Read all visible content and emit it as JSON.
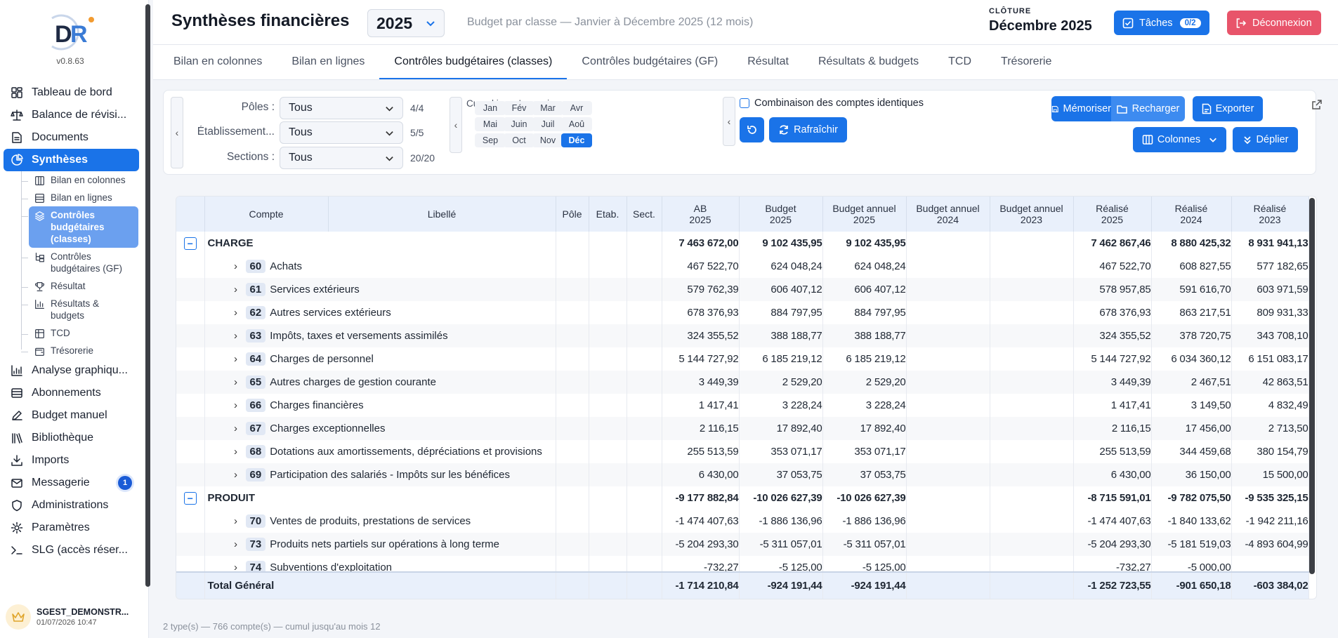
{
  "app": {
    "version": "v0.8.63",
    "user_name": "SGEST_DEMONSTR...",
    "user_date": "01/07/2026 10:47"
  },
  "sidebar": {
    "items": [
      {
        "label": "Tableau de bord",
        "icon": "dashboard-icon"
      },
      {
        "label": "Balance de révisi...",
        "icon": "scale-icon"
      },
      {
        "label": "Documents",
        "icon": "document-icon"
      },
      {
        "label": "Synthèses",
        "icon": "pie-chart-icon",
        "active": true
      }
    ],
    "sub_items": [
      {
        "label": "Bilan en colonnes",
        "icon": "columns-icon"
      },
      {
        "label": "Bilan en lignes",
        "icon": "rows-icon"
      },
      {
        "label": "Contrôles budgétaires (classes)",
        "icon": "layers-icon",
        "active": true
      },
      {
        "label": "Contrôles budgétaires (GF)",
        "icon": "hierarchy-icon"
      },
      {
        "label": "Résultat",
        "icon": "trophy-icon"
      },
      {
        "label": "Résultats & budgets",
        "icon": "bar-chart-icon"
      },
      {
        "label": "TCD",
        "icon": "table-icon"
      },
      {
        "label": "Trésorerie",
        "icon": "wallet-icon"
      }
    ],
    "items_after": [
      {
        "label": "Analyse graphiqu...",
        "icon": "chart-icon"
      },
      {
        "label": "Abonnements",
        "icon": "card-icon"
      },
      {
        "label": "Budget manuel",
        "icon": "pen-icon"
      },
      {
        "label": "Bibliothèque",
        "icon": "library-icon"
      },
      {
        "label": "Imports",
        "icon": "download-icon"
      },
      {
        "label": "Messagerie",
        "icon": "mail-icon",
        "badge": "1"
      },
      {
        "label": "Administrations",
        "icon": "shield-icon"
      },
      {
        "label": "Paramètres",
        "icon": "gear-icon"
      },
      {
        "label": "SLG (accès réser...",
        "icon": "terminal-icon"
      }
    ]
  },
  "header": {
    "title": "Synthèses financières",
    "year": "2025",
    "subtitle": "Budget par classe — Janvier à Décembre 2025 (12 mois)",
    "cloture_label": "CLÔTURE",
    "cloture_value": "Décembre 2025",
    "taches_label": "Tâches",
    "taches_count": "0/2",
    "deconnexion_label": "Déconnexion"
  },
  "tabs": [
    "Bilan en colonnes",
    "Bilan en lignes",
    "Contrôles budgétaires (classes)",
    "Contrôles budgétaires (GF)",
    "Résultat",
    "Résultats & budgets",
    "TCD",
    "Trésorerie"
  ],
  "active_tab": 2,
  "filters": {
    "poles_label": "Pôles :",
    "poles_value": "Tous",
    "poles_count": "4/4",
    "etab_label": "Établissement...",
    "etab_value": "Tous",
    "etab_count": "5/5",
    "sections_label": "Sections :",
    "sections_value": "Tous",
    "sections_count": "20/20",
    "cumul_label": "Cumul jusqu'au mois :",
    "months": [
      "Jan",
      "Fév",
      "Mar",
      "Avr",
      "Mai",
      "Juin",
      "Juil",
      "Aoû",
      "Sep",
      "Oct",
      "Nov",
      "Déc"
    ],
    "selected_month": 11,
    "combinaison_label": "Combinaison des comptes identiques",
    "rafraichir_label": "Rafraîchir",
    "memoriser_label": "Mémoriser",
    "recharger_label": "Recharger",
    "exporter_label": "Exporter",
    "colonnes_label": "Colonnes",
    "deplier_label": "Déplier"
  },
  "table": {
    "headers": {
      "compte": "Compte",
      "libelle": "Libellé",
      "pole": "Pôle",
      "etab": "Etab.",
      "sect": "Sect.",
      "ab2025_1": "AB",
      "ab2025_2": "2025",
      "b2025_1": "Budget",
      "b2025_2": "2025",
      "ba2025_1": "Budget annuel",
      "ba2025_2": "2025",
      "ba2024_1": "Budget annuel",
      "ba2024_2": "2024",
      "ba2023_1": "Budget annuel",
      "ba2023_2": "2023",
      "r2025_1": "Réalisé",
      "r2025_2": "2025",
      "r2024_1": "Réalisé",
      "r2024_2": "2024",
      "r2023_1": "Réalisé",
      "r2023_2": "2023"
    },
    "rows": [
      {
        "type": "group",
        "label": "CHARGE",
        "ab": "7 463 672,00",
        "b": "9 102 435,95",
        "ba25": "9 102 435,95",
        "ba24": "",
        "ba23": "",
        "r25": "7 462 867,46",
        "r24": "8 880 425,32",
        "r23": "8 931 941,13"
      },
      {
        "type": "row",
        "code": "60",
        "label": "Achats",
        "ab": "467 522,70",
        "b": "624 048,24",
        "ba25": "624 048,24",
        "ba24": "",
        "ba23": "",
        "r25": "467 522,70",
        "r24": "608 827,55",
        "r23": "577 182,65"
      },
      {
        "type": "row",
        "code": "61",
        "label": "Services extérieurs",
        "ab": "579 762,39",
        "b": "606 407,12",
        "ba25": "606 407,12",
        "ba24": "",
        "ba23": "",
        "r25": "578 957,85",
        "r24": "591 616,70",
        "r23": "603 971,59"
      },
      {
        "type": "row",
        "code": "62",
        "label": "Autres services extérieurs",
        "ab": "678 376,93",
        "b": "884 797,95",
        "ba25": "884 797,95",
        "ba24": "",
        "ba23": "",
        "r25": "678 376,93",
        "r24": "863 217,51",
        "r23": "809 931,33"
      },
      {
        "type": "row",
        "code": "63",
        "label": "Impôts, taxes et versements assimilés",
        "ab": "324 355,52",
        "b": "388 188,77",
        "ba25": "388 188,77",
        "ba24": "",
        "ba23": "",
        "r25": "324 355,52",
        "r24": "378 720,75",
        "r23": "343 708,10"
      },
      {
        "type": "row",
        "code": "64",
        "label": "Charges de personnel",
        "ab": "5 144 727,92",
        "b": "6 185 219,12",
        "ba25": "6 185 219,12",
        "ba24": "",
        "ba23": "",
        "r25": "5 144 727,92",
        "r24": "6 034 360,12",
        "r23": "6 151 083,17"
      },
      {
        "type": "row",
        "code": "65",
        "label": "Autres charges de gestion courante",
        "ab": "3 449,39",
        "b": "2 529,20",
        "ba25": "2 529,20",
        "ba24": "",
        "ba23": "",
        "r25": "3 449,39",
        "r24": "2 467,51",
        "r23": "42 863,51"
      },
      {
        "type": "row",
        "code": "66",
        "label": "Charges financières",
        "ab": "1 417,41",
        "b": "3 228,24",
        "ba25": "3 228,24",
        "ba24": "",
        "ba23": "",
        "r25": "1 417,41",
        "r24": "3 149,50",
        "r23": "4 832,49"
      },
      {
        "type": "row",
        "code": "67",
        "label": "Charges exceptionnelles",
        "ab": "2 116,15",
        "b": "17 892,40",
        "ba25": "17 892,40",
        "ba24": "",
        "ba23": "",
        "r25": "2 116,15",
        "r24": "17 456,00",
        "r23": "2 713,50"
      },
      {
        "type": "row",
        "code": "68",
        "label": "Dotations aux amortissements, dépréciations et provisions",
        "ab": "255 513,59",
        "b": "353 071,17",
        "ba25": "353 071,17",
        "ba24": "",
        "ba23": "",
        "r25": "255 513,59",
        "r24": "344 459,68",
        "r23": "380 154,79"
      },
      {
        "type": "row",
        "code": "69",
        "label": "Participation des salariés - Impôts sur les bénéfices",
        "ab": "6 430,00",
        "b": "37 053,75",
        "ba25": "37 053,75",
        "ba24": "",
        "ba23": "",
        "r25": "6 430,00",
        "r24": "36 150,00",
        "r23": "15 500,00"
      },
      {
        "type": "group",
        "label": "PRODUIT",
        "ab": "-9 177 882,84",
        "b": "-10 026 627,39",
        "ba25": "-10 026 627,39",
        "ba24": "",
        "ba23": "",
        "r25": "-8 715 591,01",
        "r24": "-9 782 075,50",
        "r23": "-9 535 325,15"
      },
      {
        "type": "row",
        "code": "70",
        "label": "Ventes de produits, prestations de services",
        "ab": "-1 474 407,63",
        "b": "-1 886 136,96",
        "ba25": "-1 886 136,96",
        "ba24": "",
        "ba23": "",
        "r25": "-1 474 407,63",
        "r24": "-1 840 133,62",
        "r23": "-1 942 211,16"
      },
      {
        "type": "row",
        "code": "73",
        "label": "Produits nets partiels sur opérations à long terme",
        "ab": "-5 204 293,30",
        "b": "-5 311 057,01",
        "ba25": "-5 311 057,01",
        "ba24": "",
        "ba23": "",
        "r25": "-5 204 293,30",
        "r24": "-5 181 519,03",
        "r23": "-4 893 604,99"
      },
      {
        "type": "row",
        "code": "74",
        "label": "Subventions d'exploitation",
        "ab": "-732,27",
        "b": "-5 125,00",
        "ba25": "-5 125,00",
        "ba24": "",
        "ba23": "",
        "r25": "-732,27",
        "r24": "-5 000,00",
        "r23": ""
      }
    ],
    "total": {
      "label": "Total Général",
      "ab": "-1 714 210,84",
      "b": "-924 191,44",
      "ba25": "-924 191,44",
      "ba24": "",
      "ba23": "",
      "r25": "-1 252 723,55",
      "r24": "-901 650,18",
      "r23": "-603 384,02"
    }
  },
  "footer_note": "2 type(s) — 766 compte(s) — cumul jusqu'au mois 12"
}
